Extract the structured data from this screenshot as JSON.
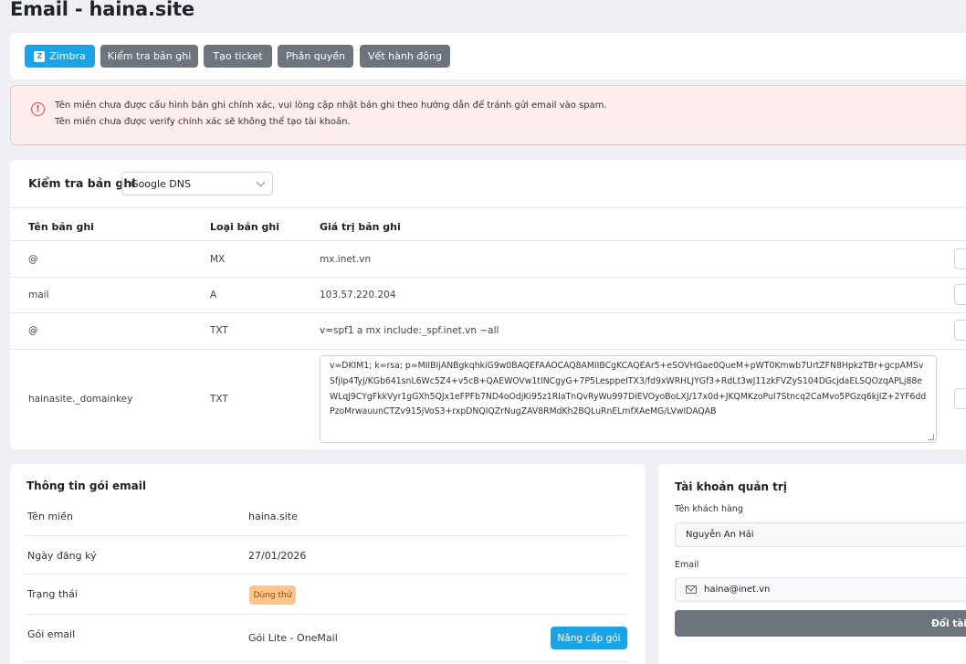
{
  "page": {
    "title": "Email - haina.site"
  },
  "toolbar": {
    "zimbra_label": "Zimbra",
    "zimbra_icon": "zimbra-logo-icon",
    "check_records_label": "Kiểm tra bản ghi",
    "create_ticket_label": "Tạo ticket",
    "permissions_label": "Phân quyền",
    "action_log_label": "Vết hành động"
  },
  "alert": {
    "color": "#e0495a",
    "icon": "alert-circle-icon",
    "line1": "Tên miền chưa được cấu hình bản ghi chính xác, vui lòng cập nhật bản ghi theo hướng dẫn để tránh gửi email vào spam.",
    "line2": "Tên miền chưa được verify chính xác sẽ không thể tạo tài khoản."
  },
  "records": {
    "label": "Kiểm tra bản ghi",
    "dns_selected": "Google DNS",
    "headers": {
      "name": "Tên bản ghi",
      "type": "Loại bản ghi",
      "value": "Giá trị bản ghi"
    },
    "rows": [
      {
        "name": "@",
        "type": "MX",
        "value": "mx.inet.vn"
      },
      {
        "name": "mail",
        "type": "A",
        "value": "103.57.220.204"
      },
      {
        "name": "@",
        "type": "TXT",
        "value": "v=spf1 a mx include:_spf.inet.vn ~all"
      },
      {
        "name": "hainasite._domainkey",
        "type": "TXT",
        "value": "v=DKIM1; k=rsa; p=MIIBIjANBgkqhkiG9w0BAQEFAAOCAQ8AMIIBCgKCAQEAr5+eSOVHGae0QueM+pWT0Kmwb7UrtZFN8HpkzTBr+gcpAMSvSfjIp4Tyj/KGb641snL6Wc5Z4+v5cB+QAEWOVw1tINCgyG+7P5LesppeITX3/fd9xWRHLJYGf3+RdLt3wJ11zkFVZyS104DGcjdaELSQOzqAPLj88eWLqJ9CYgFkkVyr1gGXh5QJx1eFPFb7ND4oOdjKi95z1RIaTnQvRyWu997DiEVOyoBoLXJ/17x0d+JKQMKzoPuI7Stncq2CaMvo5PGzq6kjIZ+2YF6ddPzoMrwauunCTZv915jVoS3+rxpDNQIQZrNugZAV8RMdKh2BQLuRnELmfXAeMG/LVwIDAQAB"
      }
    ]
  },
  "package": {
    "title": "Thông tin gói email",
    "domain_label": "Tên miền",
    "domain_value": "haina.site",
    "reg_label": "Ngày đăng ký",
    "reg_value": "27/01/2026",
    "status_label": "Trạng thái",
    "status_value": "Dùng thử",
    "status_color": "#ffc58a",
    "plan_label": "Gói email",
    "plan_value": "Gói Lite - OneMail",
    "upgrade_label": "Nâng cấp gói"
  },
  "admin": {
    "title": "Tài khoản quản trị",
    "customer_label": "Tên khách hàng",
    "customer_value": "Nguyễn An Hải",
    "email_label": "Email",
    "email_value": "haina@inet.vn",
    "email_icon": "mail-icon",
    "change_button": "Đổi tài k"
  }
}
